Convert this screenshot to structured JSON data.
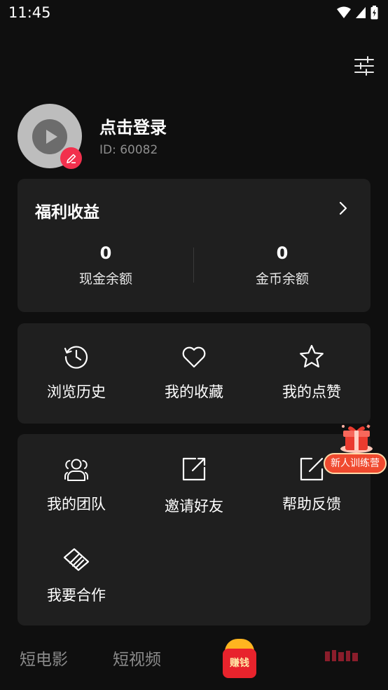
{
  "status_bar": {
    "time": "11:45"
  },
  "profile": {
    "login_label": "点击登录",
    "user_id": "ID: 60082"
  },
  "welfare": {
    "title": "福利收益",
    "cash_value": "0",
    "cash_label": "现金余额",
    "coin_value": "0",
    "coin_label": "金币余额"
  },
  "quick_actions": [
    {
      "label": "浏览历史",
      "icon": "history-icon"
    },
    {
      "label": "我的收藏",
      "icon": "heart-icon"
    },
    {
      "label": "我的点赞",
      "icon": "star-icon"
    }
  ],
  "tools": [
    {
      "label": "我的团队",
      "icon": "team-icon"
    },
    {
      "label": "邀请好友",
      "icon": "share-icon"
    },
    {
      "label": "帮助反馈",
      "icon": "edit-icon"
    },
    {
      "label": "我要合作",
      "icon": "handshake-icon"
    }
  ],
  "promo": {
    "label": "新人训练营"
  },
  "tab_bar": {
    "short_movie": "短电影",
    "short_video": "短视频",
    "earn": "赚钱"
  },
  "colors": {
    "background": "#0f0f0f",
    "card": "#1f1f1f",
    "accent_red": "#f2304d",
    "muted_text": "#8e8e8e"
  }
}
